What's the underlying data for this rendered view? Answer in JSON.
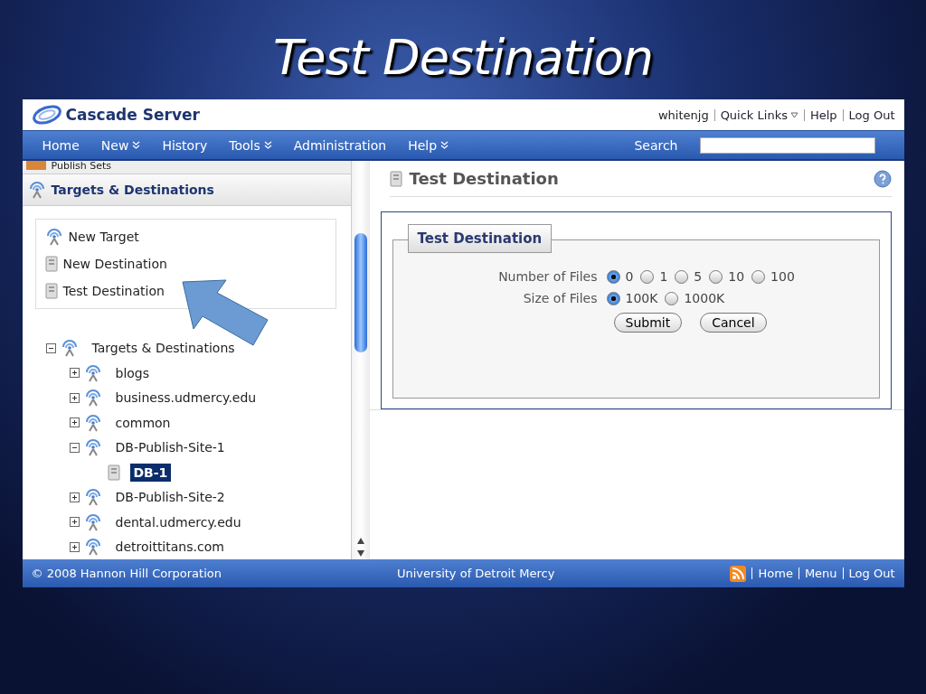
{
  "slide_title": "Test Destination",
  "header": {
    "logo": "Cascade Server",
    "user": "whitenjg",
    "links": [
      "Quick Links",
      "Help",
      "Log Out"
    ]
  },
  "nav": {
    "items": [
      {
        "label": "Home",
        "menu": false
      },
      {
        "label": "New",
        "menu": true
      },
      {
        "label": "History",
        "menu": false
      },
      {
        "label": "Tools",
        "menu": true
      },
      {
        "label": "Administration",
        "menu": false
      },
      {
        "label": "Help",
        "menu": true
      }
    ],
    "search_label": "Search"
  },
  "sidebar": {
    "clipped_section": "Publish Sets",
    "section": "Targets & Destinations",
    "actions": [
      {
        "label": "New Target",
        "kind": "target"
      },
      {
        "label": "New Destination",
        "kind": "destination"
      },
      {
        "label": "Test Destination",
        "kind": "destination"
      }
    ],
    "tree": [
      {
        "label": "Targets & Destinations",
        "kind": "target",
        "expanded": true,
        "selected": false,
        "children": [
          {
            "label": "blogs",
            "kind": "target",
            "expanded": false,
            "selected": false
          },
          {
            "label": "business.udmercy.edu",
            "kind": "target",
            "expanded": false,
            "selected": false
          },
          {
            "label": "common",
            "kind": "target",
            "expanded": false,
            "selected": false
          },
          {
            "label": "DB-Publish-Site-1",
            "kind": "target",
            "expanded": true,
            "selected": false,
            "children": [
              {
                "label": "DB-1",
                "kind": "destination",
                "selected": true
              }
            ]
          },
          {
            "label": "DB-Publish-Site-2",
            "kind": "target",
            "expanded": false,
            "selected": false
          },
          {
            "label": "dental.udmercy.edu",
            "kind": "target",
            "expanded": false,
            "selected": false
          },
          {
            "label": "detroittitans.com",
            "kind": "target",
            "expanded": false,
            "selected": false
          }
        ]
      }
    ]
  },
  "content": {
    "title": "Test Destination",
    "form": {
      "legend": "Test Destination",
      "groups": [
        {
          "label": "Number of Files",
          "options": [
            {
              "label": "0",
              "selected": true
            },
            {
              "label": "1",
              "selected": false
            },
            {
              "label": "5",
              "selected": false
            },
            {
              "label": "10",
              "selected": false
            },
            {
              "label": "100",
              "selected": false
            }
          ]
        },
        {
          "label": "Size of Files",
          "options": [
            {
              "label": "100K",
              "selected": true
            },
            {
              "label": "1000K",
              "selected": false
            }
          ]
        }
      ],
      "buttons": [
        "Submit",
        "Cancel"
      ]
    }
  },
  "footer": {
    "copyright": "© 2008 Hannon Hill Corporation",
    "center": "University of Detroit Mercy",
    "links": [
      "Home",
      "Menu",
      "Log Out"
    ]
  }
}
